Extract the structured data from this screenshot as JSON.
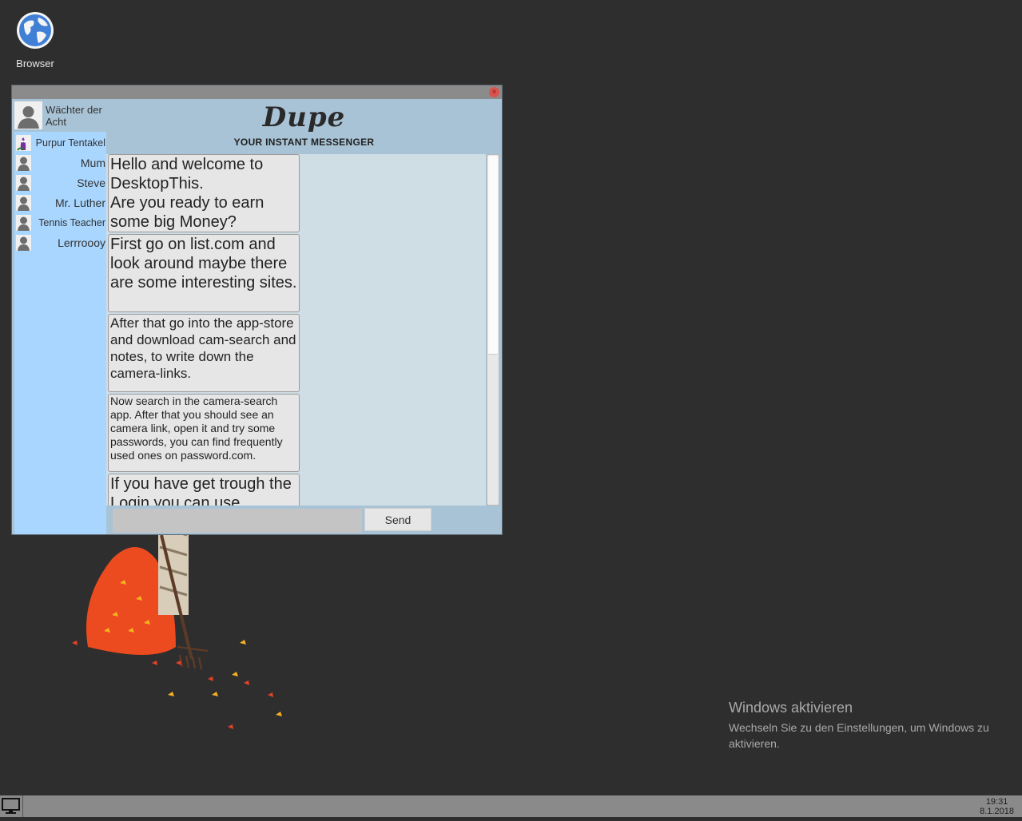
{
  "desktop": {
    "browser_icon_label": "Browser"
  },
  "messenger": {
    "logo": "Dupe",
    "tagline": "YOUR INSTANT MESSENGER",
    "current_user": "Wächter der Acht",
    "contacts": [
      {
        "name": "Purpur Tentakel"
      },
      {
        "name": "Mum"
      },
      {
        "name": "Steve"
      },
      {
        "name": "Mr. Luther"
      },
      {
        "name": "Tennis Teacher"
      },
      {
        "name": "Lerrroooy"
      }
    ],
    "messages": [
      "Hello and welcome to DesktopThis.\nAre you ready to earn some big Money?",
      "First go on list.com and look around maybe there are some interesting sites.",
      "After that go into the app-store and download cam-search and notes, to write down the camera-links.",
      "Now search in the camera-search app. After that you should see an camera link, open it and try some passwords, you can find frequently used ones on password.com.",
      "If you have get trough the Login you can use"
    ],
    "input_value": "",
    "send_label": "Send",
    "close_glyph": "×"
  },
  "activation": {
    "title": "Windows aktivieren",
    "subtitle": "Wechseln Sie zu den Einstellungen, um Windows zu aktivieren."
  },
  "taskbar": {
    "time": "19:31",
    "date": "8.1.2018"
  }
}
